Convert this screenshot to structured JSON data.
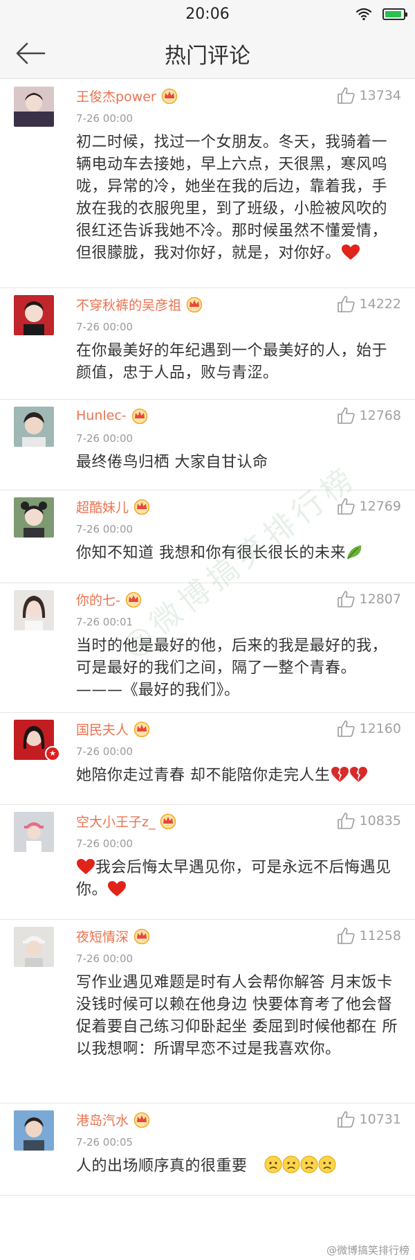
{
  "status_bar": {
    "time": "20:06"
  },
  "nav": {
    "title": "热门评论"
  },
  "comments": [
    {
      "author": "王俊杰power",
      "time": "7-26 00:00",
      "likes": "13734",
      "text": "初二时候，找过一个女朋友。冬天，我骑着一辆电动车去接她，早上六点，天很黑，寒风呜咙，异常的冷，她坐在我的后边，靠着我，手放在我的衣服兜里，到了班级，小脸被风吹的很红还告诉我她不冷。那时候虽然不懂爱情，但很朦胧，我对你好，就是，对你好。"
    },
    {
      "author": "不穿秋裤的吴彦祖",
      "time": "7-26 00:00",
      "likes": "14222",
      "text": "在你最美好的年纪遇到一个最美好的人，始于颜值，忠于人品，败与青涩。"
    },
    {
      "author": "Hunlec-",
      "time": "7-26 00:00",
      "likes": "12768",
      "text": "最终倦鸟归栖 大家自甘认命"
    },
    {
      "author": "超酷妹儿",
      "time": "7-26 00:00",
      "likes": "12769",
      "text": "你知不知道 我想和你有很长很长的未来"
    },
    {
      "author": "你的七-",
      "time": "7-26 00:01",
      "likes": "12807",
      "text": "当时的他是最好的他，后来的我是最好的我，可是最好的我们之间，隔了一整个青春。",
      "text_suffix": "———《最好的我们》。"
    },
    {
      "author": "国民夫人",
      "time": "7-26 00:00",
      "likes": "12160",
      "text": "她陪你走过青春 却不能陪你走完人生"
    },
    {
      "author": "空大小王子z_",
      "time": "7-26 00:00",
      "likes": "10835",
      "text": "我会后悔太早遇见你，可是永远不后悔遇见你。"
    },
    {
      "author": "夜短情深",
      "time": "7-26 00:00",
      "likes": "11258",
      "text": "写作业遇见难题是时有人会帮你解答 月末饭卡没钱时候可以赖在他身边  快要体育考了他会督促着要自己练习仰卧起坐   委屈到时候他都在 所以我想啊：所谓早恋不过是我喜欢你。"
    },
    {
      "author": "港岛汽水",
      "time": "7-26 00:05",
      "likes": "10731",
      "text": "人的出场顺序真的很重要"
    }
  ],
  "watermark": "@微博搞笑排行榜",
  "footer_watermark": "@微博搞笑排行榜",
  "colors": {
    "author": "#eb7350",
    "heart": "#e2231a",
    "crown": "#f5a623"
  }
}
